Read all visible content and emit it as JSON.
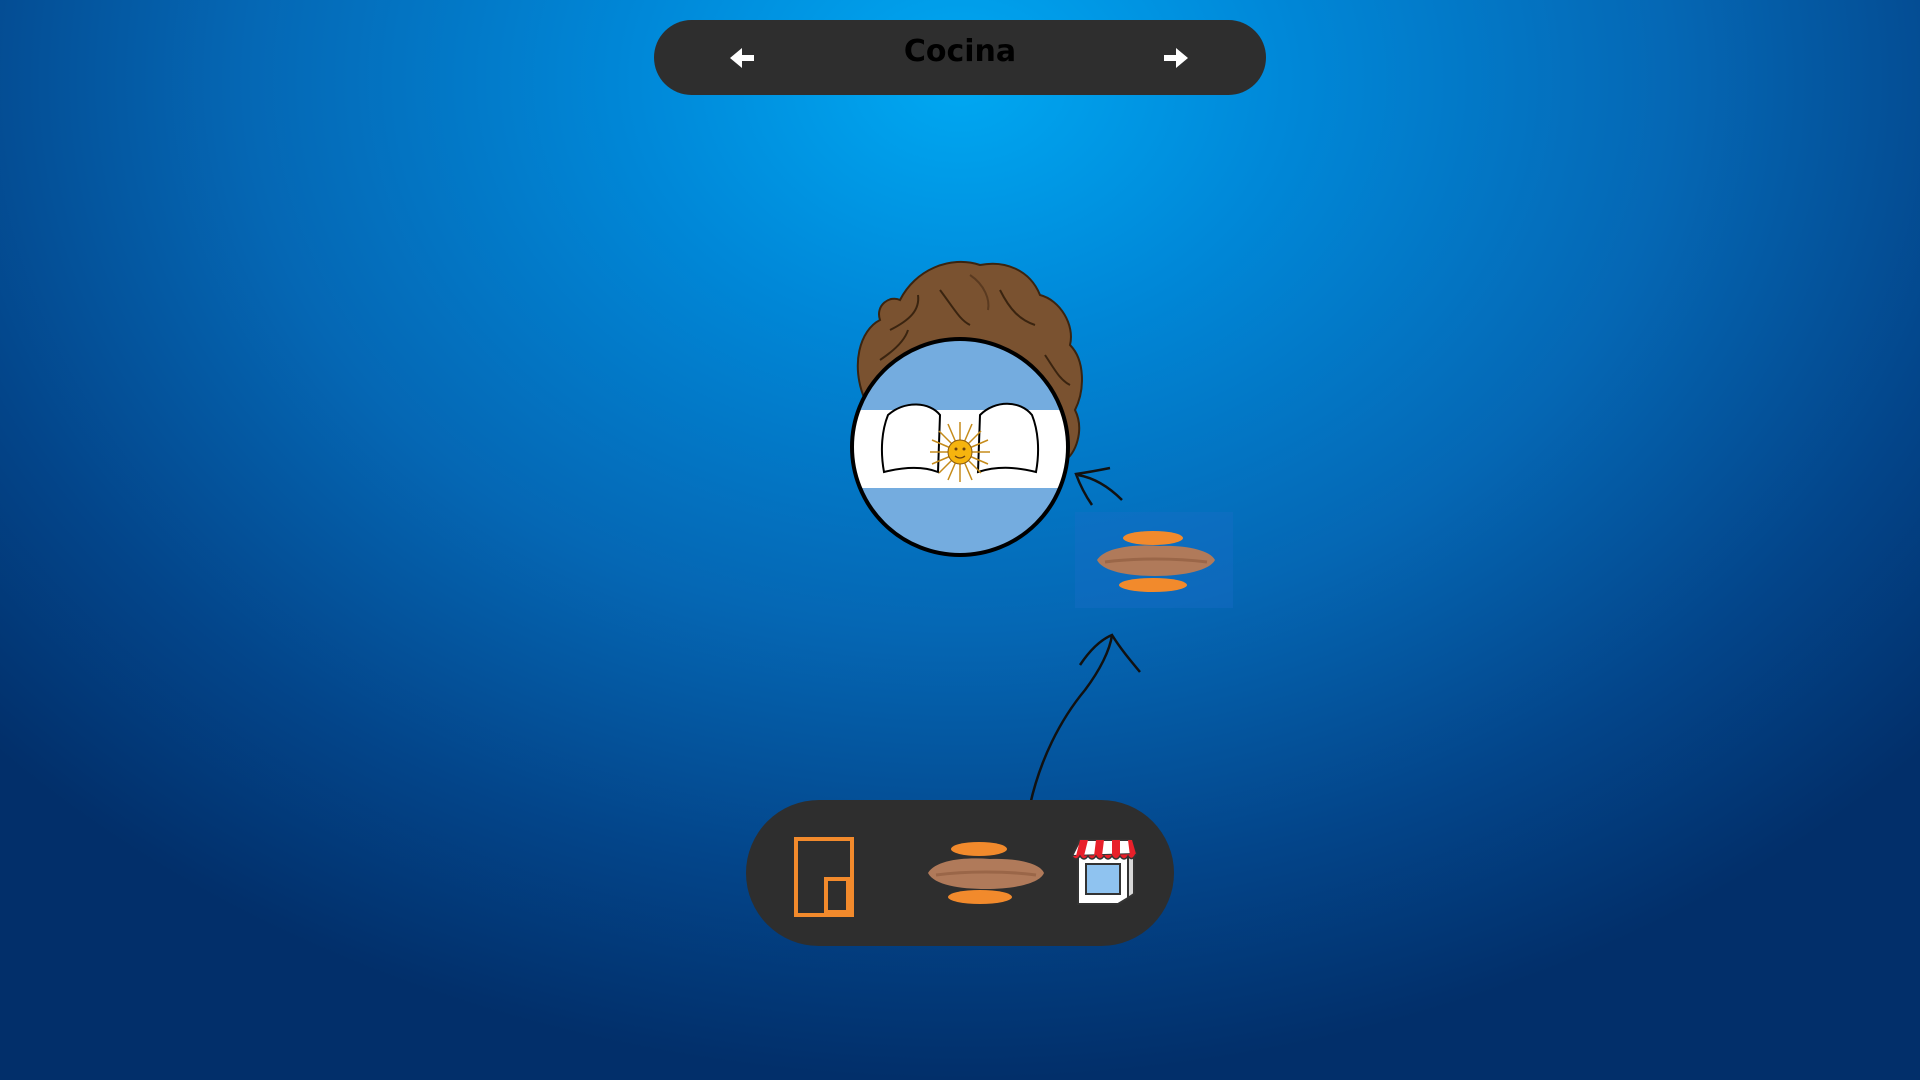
{
  "header": {
    "room_title": "Cocina",
    "prev_icon": "arrow-left-icon",
    "next_icon": "arrow-right-icon"
  },
  "character": {
    "name": "argentina-countryball",
    "flag_colors": {
      "light_blue": "#74acdf",
      "white": "#ffffff",
      "sun": "#f6b40e"
    },
    "hair_color": "#7a5230"
  },
  "drop_zone": {
    "item": "food-icon"
  },
  "dock": {
    "items": [
      {
        "name": "door-icon",
        "color": "#f28a2c"
      },
      {
        "name": "food-icon",
        "color": "#f28a2c"
      },
      {
        "name": "shop-icon",
        "color": "#e8202a"
      }
    ]
  },
  "colors": {
    "panel": "#2e2e2e",
    "accent": "#f28a2c",
    "background_top": "#00a8f2",
    "background_bottom": "#022f6a"
  }
}
